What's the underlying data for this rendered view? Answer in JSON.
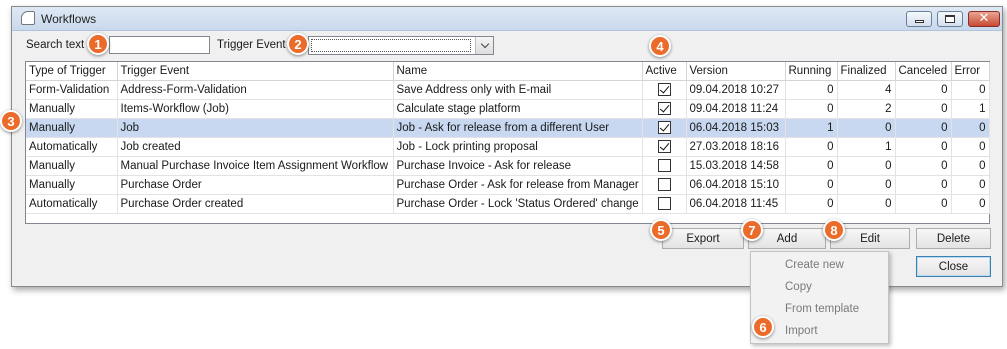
{
  "window": {
    "title": "Workflows"
  },
  "filters": {
    "search_label": "Search text",
    "search_value": "",
    "trigger_label": "Trigger Event",
    "trigger_value": ""
  },
  "grid": {
    "columns": [
      "Type of Trigger",
      "Trigger Event",
      "Name",
      "Active",
      "Version",
      "Running",
      "Finalized",
      "Canceled",
      "Error"
    ],
    "rows": [
      {
        "type": "Form-Validation",
        "event": "Address-Form-Validation",
        "name": "Save Address only with E-mail",
        "active": true,
        "version": "09.04.2018 10:27",
        "running": "0",
        "finalized": "4",
        "canceled": "0",
        "error": "0",
        "selected": false
      },
      {
        "type": "Manually",
        "event": "Items-Workflow (Job)",
        "name": "Calculate stage platform",
        "active": true,
        "version": "09.04.2018 11:24",
        "running": "0",
        "finalized": "2",
        "canceled": "0",
        "error": "1",
        "selected": false
      },
      {
        "type": "Manually",
        "event": "Job",
        "name": "Job - Ask for release from a different User",
        "active": true,
        "version": "06.04.2018 15:03",
        "running": "1",
        "finalized": "0",
        "canceled": "0",
        "error": "0",
        "selected": true
      },
      {
        "type": "Automatically",
        "event": "Job created",
        "name": "Job - Lock printing proposal",
        "active": true,
        "version": "27.03.2018 18:16",
        "running": "0",
        "finalized": "1",
        "canceled": "0",
        "error": "0",
        "selected": false
      },
      {
        "type": "Manually",
        "event": "Manual Purchase Invoice Item Assignment Workflow",
        "name": "Purchase Invoice - Ask for release",
        "active": false,
        "version": "15.03.2018 14:58",
        "running": "0",
        "finalized": "0",
        "canceled": "0",
        "error": "0",
        "selected": false
      },
      {
        "type": "Manually",
        "event": "Purchase Order",
        "name": "Purchase Order - Ask for release from Manager",
        "active": false,
        "version": "06.04.2018 15:10",
        "running": "0",
        "finalized": "0",
        "canceled": "0",
        "error": "0",
        "selected": false
      },
      {
        "type": "Automatically",
        "event": "Purchase Order created",
        "name": "Purchase Order - Lock 'Status Ordered' change",
        "active": false,
        "version": "06.04.2018 11:45",
        "running": "0",
        "finalized": "0",
        "canceled": "0",
        "error": "0",
        "selected": false
      }
    ]
  },
  "buttons": {
    "export": "Export",
    "add": "Add",
    "edit": "Edit",
    "delete": "Delete",
    "close": "Close"
  },
  "add_menu": {
    "items": [
      "Create new",
      "Copy",
      "From template",
      "Import"
    ]
  },
  "badges": [
    "1",
    "2",
    "3",
    "4",
    "5",
    "6",
    "7",
    "8"
  ],
  "colors": {
    "badge": "#ea6b2a",
    "selected_row": "#c7d8f0",
    "title_bar": "#c9d9ed"
  }
}
